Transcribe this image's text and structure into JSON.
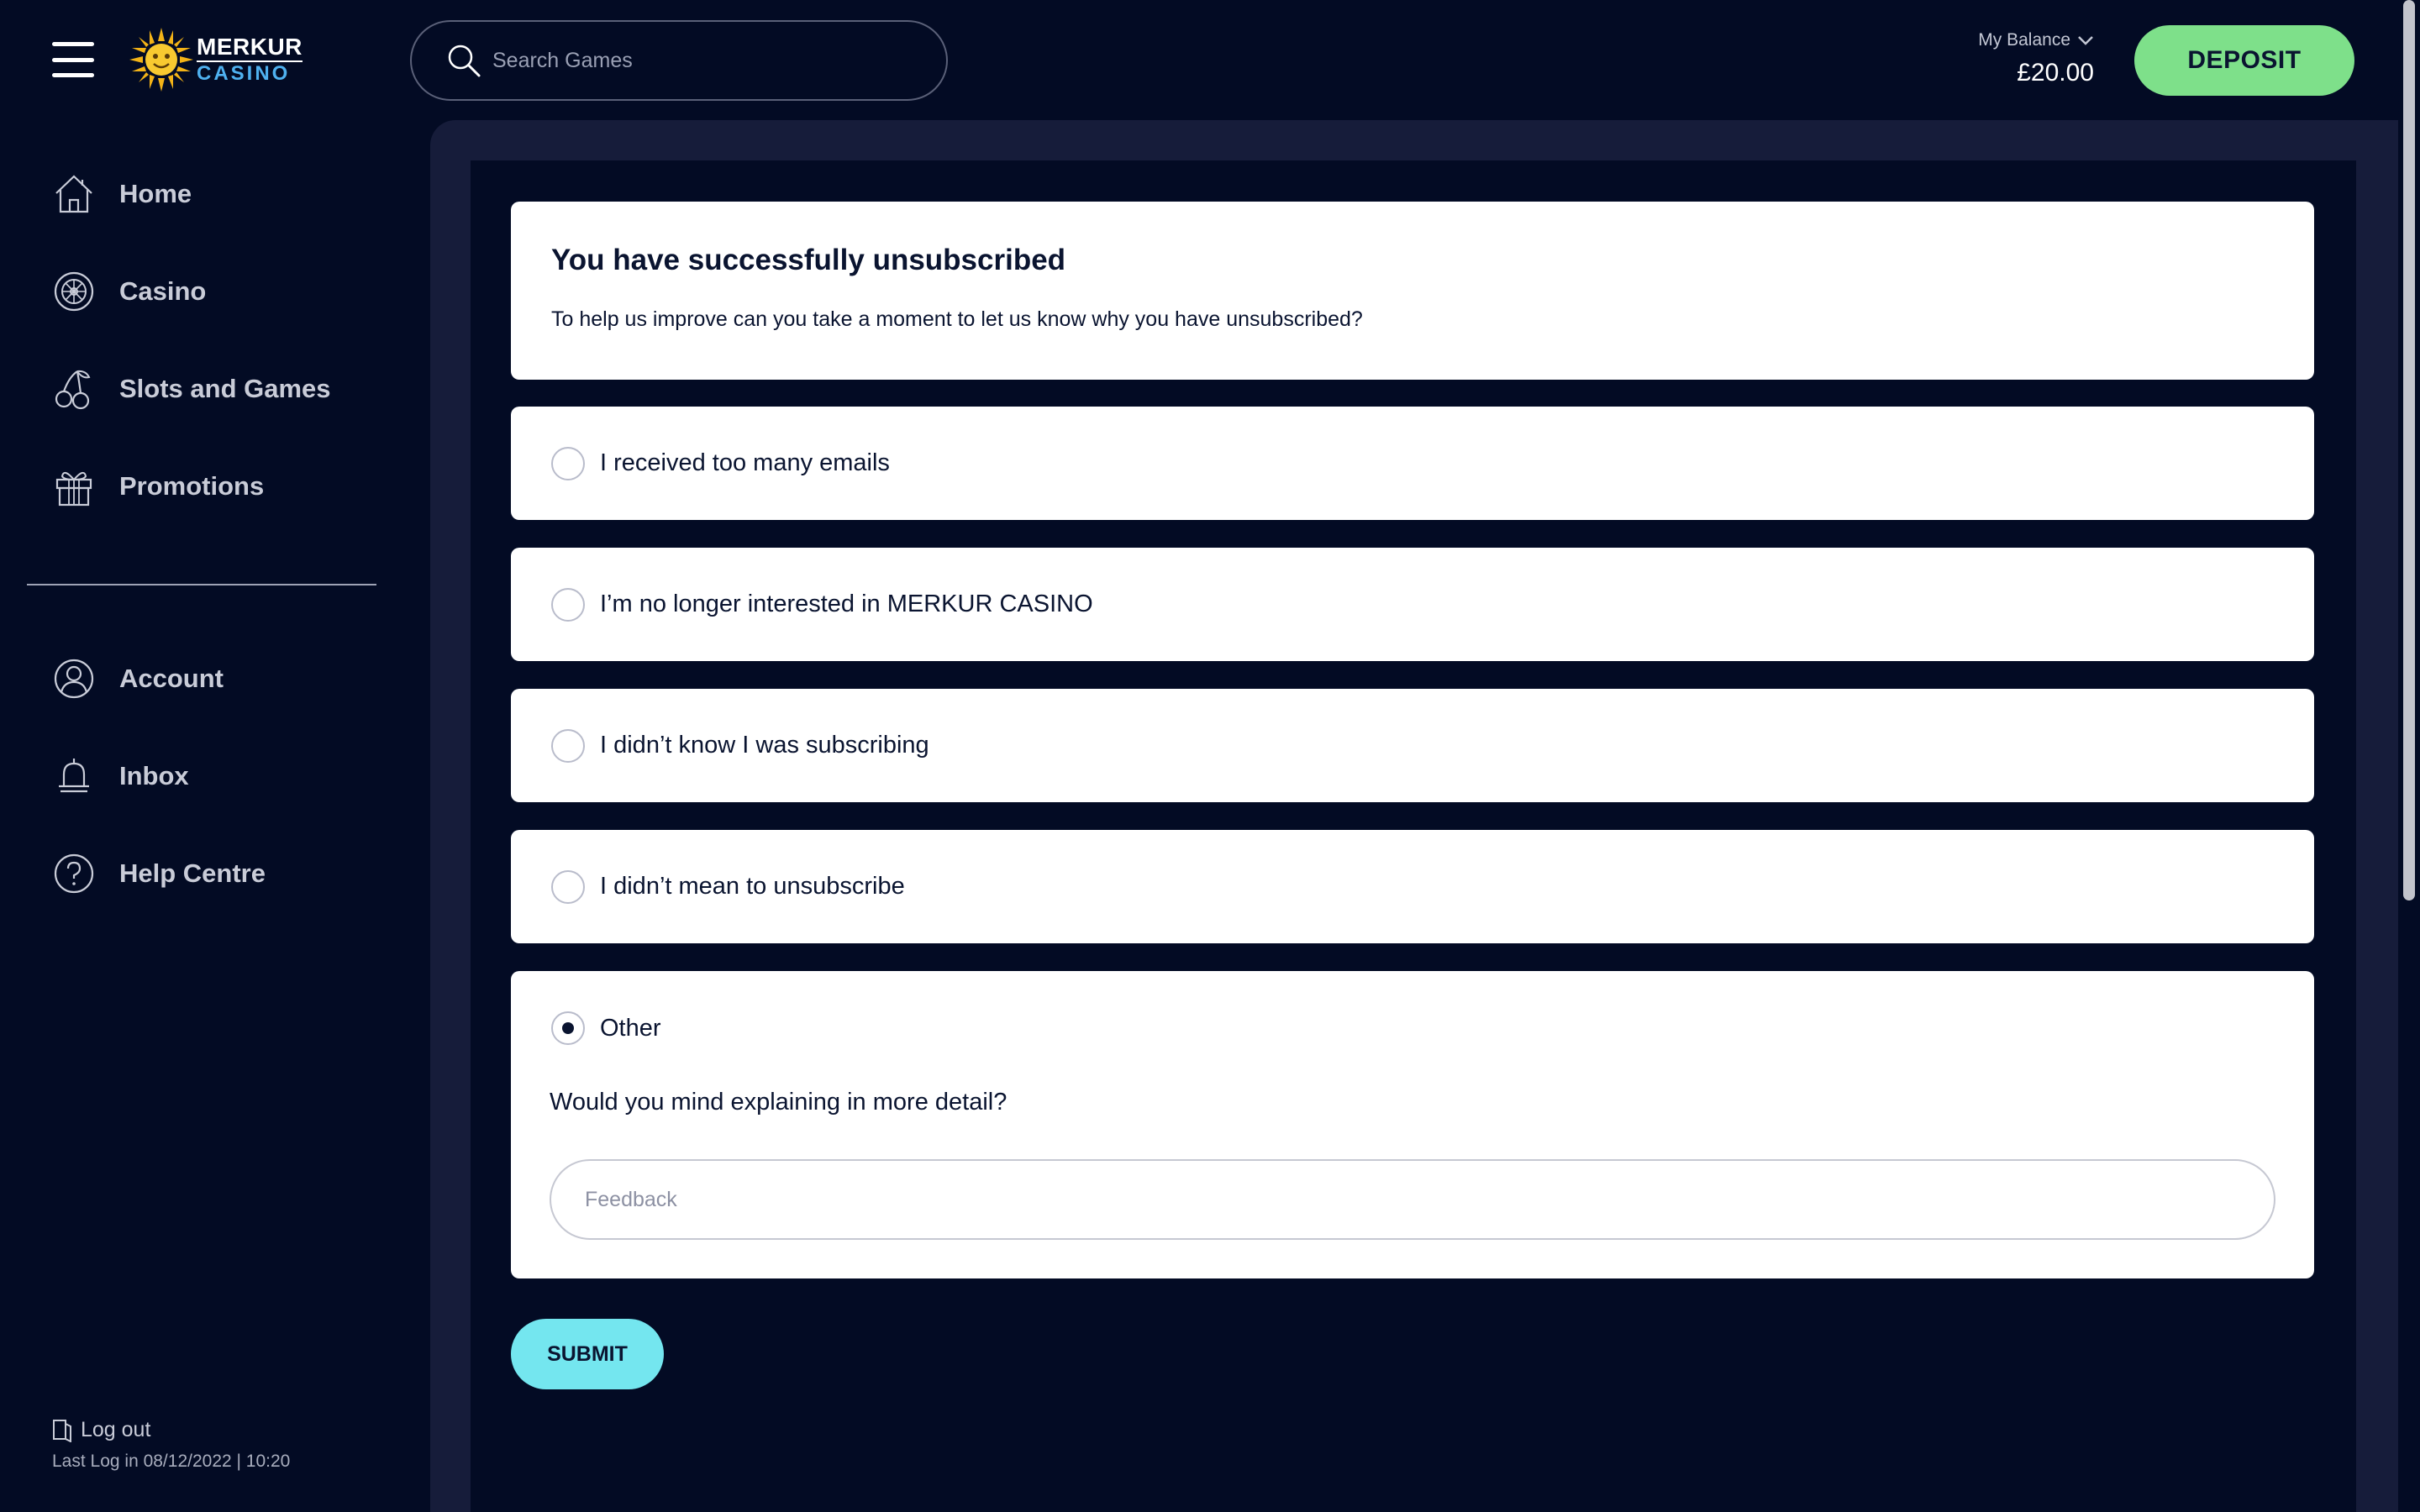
{
  "header": {
    "logo": {
      "line1": "MERKUR",
      "line2": "CASINO"
    },
    "search": {
      "placeholder": "Search Games",
      "value": ""
    },
    "balance": {
      "label": "My Balance",
      "amount": "£20.00"
    },
    "deposit_label": "DEPOSIT"
  },
  "sidebar": {
    "items": [
      {
        "label": "Home",
        "icon": "home-icon"
      },
      {
        "label": "Casino",
        "icon": "roulette-icon"
      },
      {
        "label": "Slots and Games",
        "icon": "cherries-icon"
      },
      {
        "label": "Promotions",
        "icon": "gift-icon"
      },
      {
        "label": "Account",
        "icon": "user-icon"
      },
      {
        "label": "Inbox",
        "icon": "bell-icon"
      },
      {
        "label": "Help Centre",
        "icon": "help-icon"
      }
    ],
    "logout_label": "Log out",
    "last_login": "Last Log in 08/12/2022 | 10:20"
  },
  "main": {
    "title": "You have successfully unsubscribed",
    "subtitle": "To help us improve can you take a moment to let us know why you have unsubscribed?",
    "options": [
      {
        "label": "I received too many emails",
        "selected": false
      },
      {
        "label": "I’m no longer interested in MERKUR CASINO",
        "selected": false
      },
      {
        "label": "I didn’t know I was subscribing",
        "selected": false
      },
      {
        "label": "I didn’t mean to unsubscribe",
        "selected": false
      },
      {
        "label": "Other",
        "selected": true
      }
    ],
    "detail_question": "Would you mind explaining in more detail?",
    "feedback": {
      "placeholder": "Feedback",
      "value": ""
    },
    "submit_label": "SUBMIT"
  },
  "colors": {
    "background": "#030b24",
    "panel": "#161c3a",
    "deposit": "#7ee08a",
    "submit": "#74e6ef",
    "logo_accent": "#4fb1f0"
  }
}
